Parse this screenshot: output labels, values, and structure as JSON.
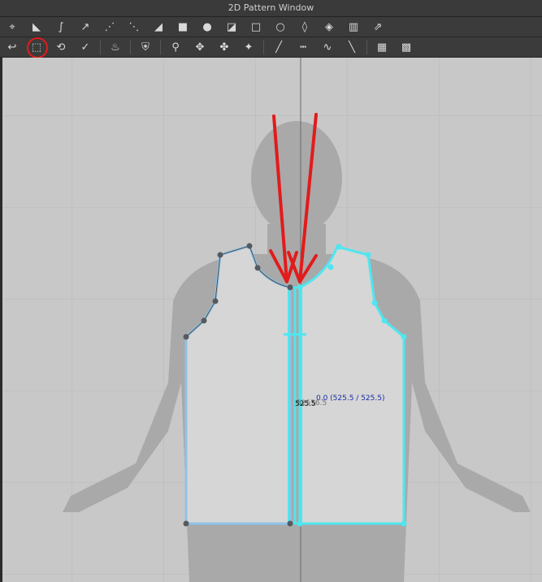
{
  "window": {
    "title": "2D Pattern Window"
  },
  "toolbar_rows": [
    {
      "name": "edit-tools-row",
      "tools": [
        "select-point-icon",
        "edit-point-icon",
        "curve-point-icon",
        "curve-edit-icon",
        "add-point-icon",
        "split-segment-icon",
        "polygon-icon",
        "rectangle-icon",
        "circle-icon",
        "internal-polygon-icon",
        "internal-rectangle-icon",
        "internal-circle-icon",
        "dart-icon",
        "darts-icon",
        "pleat-icon",
        "fold-icon"
      ]
    },
    {
      "name": "sewing-tools-row",
      "tools": [
        "sew-segment-icon",
        "sew-free-icon",
        "sew-multi-icon",
        "sew-check-icon",
        "iron-icon",
        "shirt-arrange-icon",
        "tack-icon",
        "pin-icon",
        "fold-arrangement-icon",
        "arrangement-point-icon",
        "line-segment-icon",
        "topstitch-icon",
        "seam-tape-icon",
        "straight-line-icon",
        "texture-edit-icon",
        "texture-select-icon"
      ]
    }
  ],
  "canvas": {
    "measurement_label": "525.5",
    "measurement_overlay": "52556.5",
    "coordinate_readout": "0.0 (525.5 / 525.5)"
  },
  "colors": {
    "annotation": "#e21b1b",
    "selected_pattern": "#4fe6f0",
    "pattern_outline": "#8ec3e6",
    "point": "#555a60"
  }
}
